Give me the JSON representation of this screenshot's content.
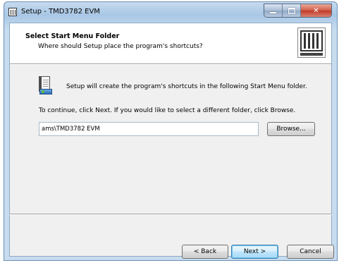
{
  "window": {
    "title": "Setup - TMD3782 EVM"
  },
  "header": {
    "title": "Select Start Menu Folder",
    "subtitle": "Where should Setup place the program's shortcuts?"
  },
  "body": {
    "info": "Setup will create the program's shortcuts in the following Start Menu folder.",
    "instruction": "To continue, click Next. If you would like to select a different folder, click Browse.",
    "folder_value": "ams\\TMD3782 EVM",
    "browse_label": "Browse..."
  },
  "footer": {
    "back_label": "< Back",
    "next_label": "Next >",
    "cancel_label": "Cancel"
  },
  "colors": {
    "title_bar": "#b9d2eb",
    "close_button": "#c0392b",
    "default_button_border": "#3c7fb1",
    "dialog_background": "#f0f0f0"
  },
  "icons": {
    "window_icon": "setup-app-icon",
    "header_image": "wizard-logo-icon",
    "page_icon": "start-menu-folder-icon"
  }
}
